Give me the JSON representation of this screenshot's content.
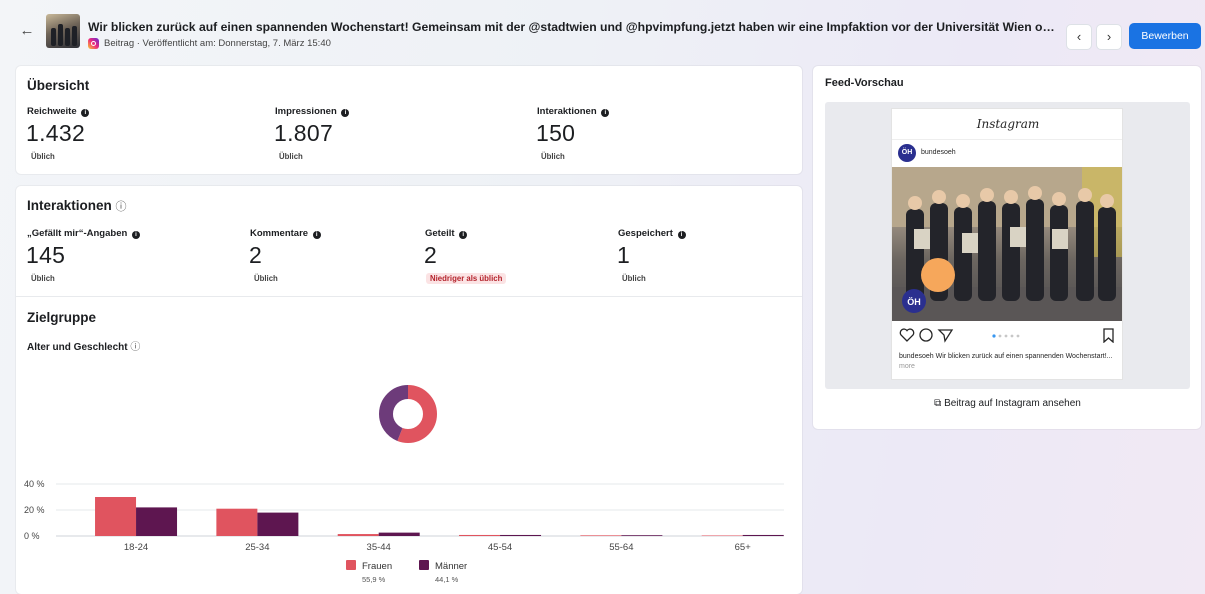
{
  "header": {
    "back_icon": "arrow-left-icon",
    "title": "Wir blicken zurück auf einen spannenden Wochenstart! Gemeinsam mit der @stadtwien und @hpvimpfung.jetzt haben wir eine Impfaktion vor der Universität Wien organisiert...",
    "meta": "Beitrag · Veröffentlicht am: Donnerstag, 7. März 15:40",
    "platform_icon": "instagram-icon",
    "prev_icon": "chevron-left-icon",
    "next_icon": "chevron-right-icon",
    "apply_label": "Bewerben",
    "accent": "#1a73e3"
  },
  "overview": {
    "title": "Übersicht",
    "metrics": [
      {
        "label": "Reichweite",
        "value": "1.432",
        "badge": "Üblich"
      },
      {
        "label": "Impressionen",
        "value": "1.807",
        "badge": "Üblich"
      },
      {
        "label": "Interaktionen",
        "value": "150",
        "badge": "Üblich"
      }
    ]
  },
  "interactions": {
    "title": "Interaktionen",
    "metrics": [
      {
        "label": "„Gefällt mir“-Angaben",
        "value": "145",
        "badge": "Üblich"
      },
      {
        "label": "Kommentare",
        "value": "2",
        "badge": "Üblich"
      },
      {
        "label": "Geteilt",
        "value": "2",
        "badge": "Niedriger als üblich"
      },
      {
        "label": "Gespeichert",
        "value": "1",
        "badge": "Üblich"
      }
    ],
    "low_color": "#b4232c"
  },
  "audience": {
    "title": "Zielgruppe",
    "subtitle": "Alter und Geschlecht"
  },
  "chart_data": [
    {
      "type": "pie",
      "style": "donut",
      "labels": [
        "Frauen",
        "Männer"
      ],
      "values": [
        55.9,
        44.1
      ],
      "colors": [
        "#e0545f",
        "#6d3b7a"
      ]
    },
    {
      "type": "bar",
      "categories": [
        "18-24",
        "25-34",
        "35-44",
        "45-54",
        "55-64",
        "65+"
      ],
      "series": [
        {
          "name": "Frauen",
          "color": "#e0545f",
          "values": [
            30,
            21,
            1.5,
            0.8,
            0.5,
            0.4
          ],
          "share": "55,9 %"
        },
        {
          "name": "Männer",
          "color": "#5e1650",
          "values": [
            22,
            18,
            2.6,
            0.8,
            0.6,
            0.8
          ],
          "share": "44,1 %"
        }
      ],
      "y_ticks": [
        "0 %",
        "20 %",
        "40 %"
      ],
      "ylim": [
        0,
        40
      ],
      "grid": true,
      "legend": "bottom"
    }
  ],
  "preview": {
    "title": "Feed-Vorschau",
    "logo_text": "Instagram",
    "avatar_text": "ÖH",
    "username": "bundesoeh",
    "caption_user": "bundesoeh",
    "caption_text": "Wir blicken zurück auf einen spannenden Wochenstart!...",
    "caption_more": "more",
    "badge_logo": "ÖH",
    "link_label": "Beitrag auf Instagram ansehen",
    "link_icon": "external-link-icon"
  }
}
